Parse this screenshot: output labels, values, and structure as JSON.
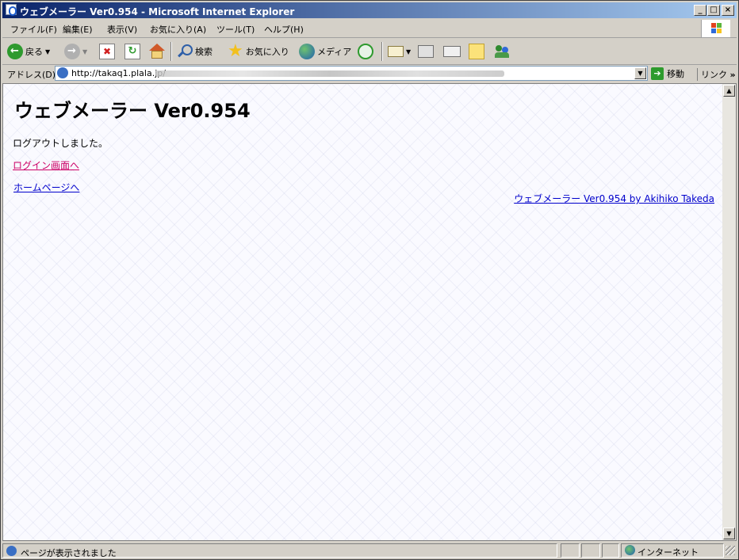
{
  "window": {
    "title": "ウェブメーラー Ver0.954 - Microsoft Internet Explorer",
    "minimize": "_",
    "maximize": "□",
    "close": "×"
  },
  "menu": {
    "items": [
      "ファイル(F)",
      "編集(E)",
      "表示(V)",
      "お気に入り(A)",
      "ツール(T)",
      "ヘルプ(H)"
    ]
  },
  "toolbar": {
    "back": "戻る",
    "search": "検索",
    "favorites": "お気に入り",
    "media": "メディア"
  },
  "address": {
    "label": "アドレス(D)",
    "url": "http://takaq1.plala.jp/",
    "go": "移動",
    "links": "リンク",
    "links_more": "»"
  },
  "page": {
    "title": "ウェブメーラー Ver0.954",
    "message": "ログアウトしました。",
    "login_link": "ログイン画面へ",
    "home_link": "ホームページへ",
    "credit_link": "ウェブメーラー Ver0.954 by Akihiko Takeda"
  },
  "status": {
    "text": "ページが表示されました",
    "zone": "インターネット"
  },
  "colors": {
    "visited_link": "#cc0066",
    "link": "#0000cc",
    "titlebar_start": "#0a246a",
    "titlebar_end": "#a6caf0"
  }
}
